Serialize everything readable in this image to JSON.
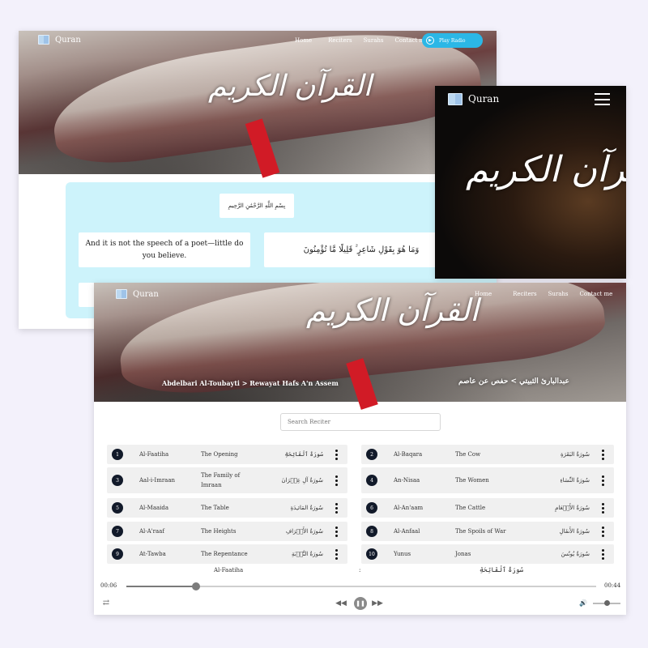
{
  "brand": {
    "name": "Quran",
    "accent": "#2bb7e6",
    "number_badge": "#121a2a",
    "panel_bg": "#cdf3fb"
  },
  "desktop_home": {
    "nav": [
      "Home",
      "Reciters",
      "Surahs",
      "Contact me"
    ],
    "play_radio_label": "Play Radio",
    "hero_title_arabic": "القرآن الكريم",
    "basmala": "بِسْمِ اللَّهِ الرَّحْمَٰنِ الرَّحِيمِ",
    "verse_translation": "And it is not the speech of a poet—little do you believe.",
    "verse_arabic": "وَمَا هُوَ بِقَوْلِ شَاعِرٍ ۚ قَلِيلًا مَّا تُؤْمِنُونَ"
  },
  "mobile": {
    "hero_title_arabic": "القرآن الكريم",
    "menu_icon": "hamburger-icon"
  },
  "reciter_page": {
    "nav": [
      "Home",
      "Reciters",
      "Surahs",
      "Contact me"
    ],
    "hero_title_arabic": "القرآن الكريم",
    "breadcrumb_en": "Abdelbari Al-Toubayti > Rewayat Hafs A'n Assem",
    "breadcrumb_ar": "عبدالبارئ الثبيتي > حفص عن عاصم",
    "search_placeholder": "Search Reciter",
    "surahs": [
      {
        "num": "1",
        "name": "Al-Faatiha",
        "english": "The Opening",
        "arabic": "سُورَةُ ٱلْفَاتِحَةِ"
      },
      {
        "num": "2",
        "name": "Al-Baqara",
        "english": "The Cow",
        "arabic": "سُورَةُ البَقَرَةِ"
      },
      {
        "num": "3",
        "name": "Aal-i-Imraan",
        "english": "The Family of Imraan",
        "arabic": "سُورَةُ آلِ عِمۡرَانَ"
      },
      {
        "num": "4",
        "name": "An-Nisaa",
        "english": "The Women",
        "arabic": "سُورَةُ النِّسَاءِ"
      },
      {
        "num": "5",
        "name": "Al-Maaida",
        "english": "The Table",
        "arabic": "سُورَةُ المَائـِدَةِ"
      },
      {
        "num": "6",
        "name": "Al-An'aam",
        "english": "The Cattle",
        "arabic": "سُورَةُ الأَنۡعَامِ"
      },
      {
        "num": "7",
        "name": "Al-A'raaf",
        "english": "The Heights",
        "arabic": "سُورَةُ الأَعۡرَافِ"
      },
      {
        "num": "8",
        "name": "Al-Anfaal",
        "english": "The Spoils of War",
        "arabic": "سُورَةُ الأَنفَالِ"
      },
      {
        "num": "9",
        "name": "At-Tawba",
        "english": "The Repentance",
        "arabic": "سُورَةُ التَّوۡبَةِ"
      },
      {
        "num": "10",
        "name": "Yunus",
        "english": "Jonas",
        "arabic": "سُورَةُ يُونُسَ"
      }
    ],
    "player": {
      "now_playing_en": "Al-Faatiha",
      "separator": ":",
      "now_playing_ar": "سُورَةُ ٱلْفَاتِحَةِ",
      "current_time": "00:06",
      "duration": "00:44",
      "progress": 0.148,
      "volume": 0.5
    }
  }
}
